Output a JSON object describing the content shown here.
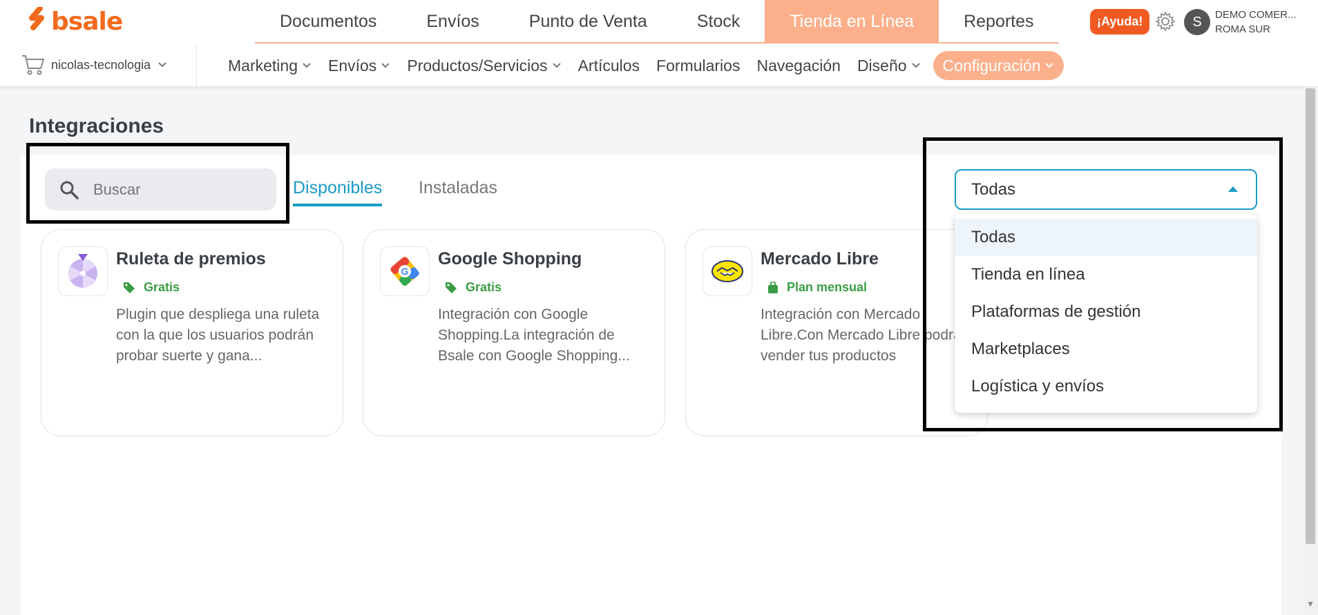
{
  "brand": {
    "name": "bsale",
    "color": "#f26b1d"
  },
  "main_nav": {
    "items": [
      "Documentos",
      "Envíos",
      "Punto de Venta",
      "Stock",
      "Tienda en Línea",
      "Reportes"
    ],
    "active": "Tienda en Línea"
  },
  "header": {
    "help_label": "¡Ayuda!",
    "settings_icon": "gear-icon",
    "avatar_initial": "S",
    "account_line1": "DEMO COMER...",
    "account_line2": "ROMA SUR"
  },
  "store_selector": {
    "icon": "cart-icon",
    "name": "nicolas-tecnologia"
  },
  "sub_nav": {
    "items": [
      {
        "label": "Marketing",
        "has_menu": true
      },
      {
        "label": "Envíos",
        "has_menu": true
      },
      {
        "label": "Productos/Servicios",
        "has_menu": true
      },
      {
        "label": "Artículos",
        "has_menu": false
      },
      {
        "label": "Formularios",
        "has_menu": false
      },
      {
        "label": "Navegación",
        "has_menu": false
      },
      {
        "label": "Diseño",
        "has_menu": true
      },
      {
        "label": "Configuración",
        "has_menu": true
      }
    ],
    "active": "Configuración"
  },
  "page": {
    "title": "Integraciones",
    "search_placeholder": "Buscar",
    "tabs": [
      {
        "label": "Disponibles",
        "active": true
      },
      {
        "label": "Instaladas",
        "active": false
      }
    ],
    "filter": {
      "selected": "Todas",
      "options": [
        "Todas",
        "Tienda en línea",
        "Plataformas de gestión",
        "Marketplaces",
        "Logística y envíos"
      ]
    }
  },
  "integrations": [
    {
      "title": "Ruleta de premios",
      "badge": "Gratis",
      "badge_icon": "tag-icon",
      "icon": "roulette-icon",
      "description": "Plugin que despliega una ruleta con la que los usuarios podrán probar suerte y gana..."
    },
    {
      "title": "Google Shopping",
      "badge": "Gratis",
      "badge_icon": "tag-icon",
      "icon": "google-shopping-icon",
      "description": "Integración con Google Shopping.La integración de Bsale con Google Shopping..."
    },
    {
      "title": "Mercado Libre",
      "badge": "Plan mensual",
      "badge_icon": "bag-icon",
      "icon": "mercado-libre-icon",
      "description": "Integración con Mercado Libre.Con Mercado Libre podrás vender tus productos"
    }
  ],
  "colors": {
    "accent_orange": "#fbb08b",
    "help_orange": "#f05a22",
    "accent_blue": "#1a9bc4",
    "badge_green": "#3a9d45"
  }
}
